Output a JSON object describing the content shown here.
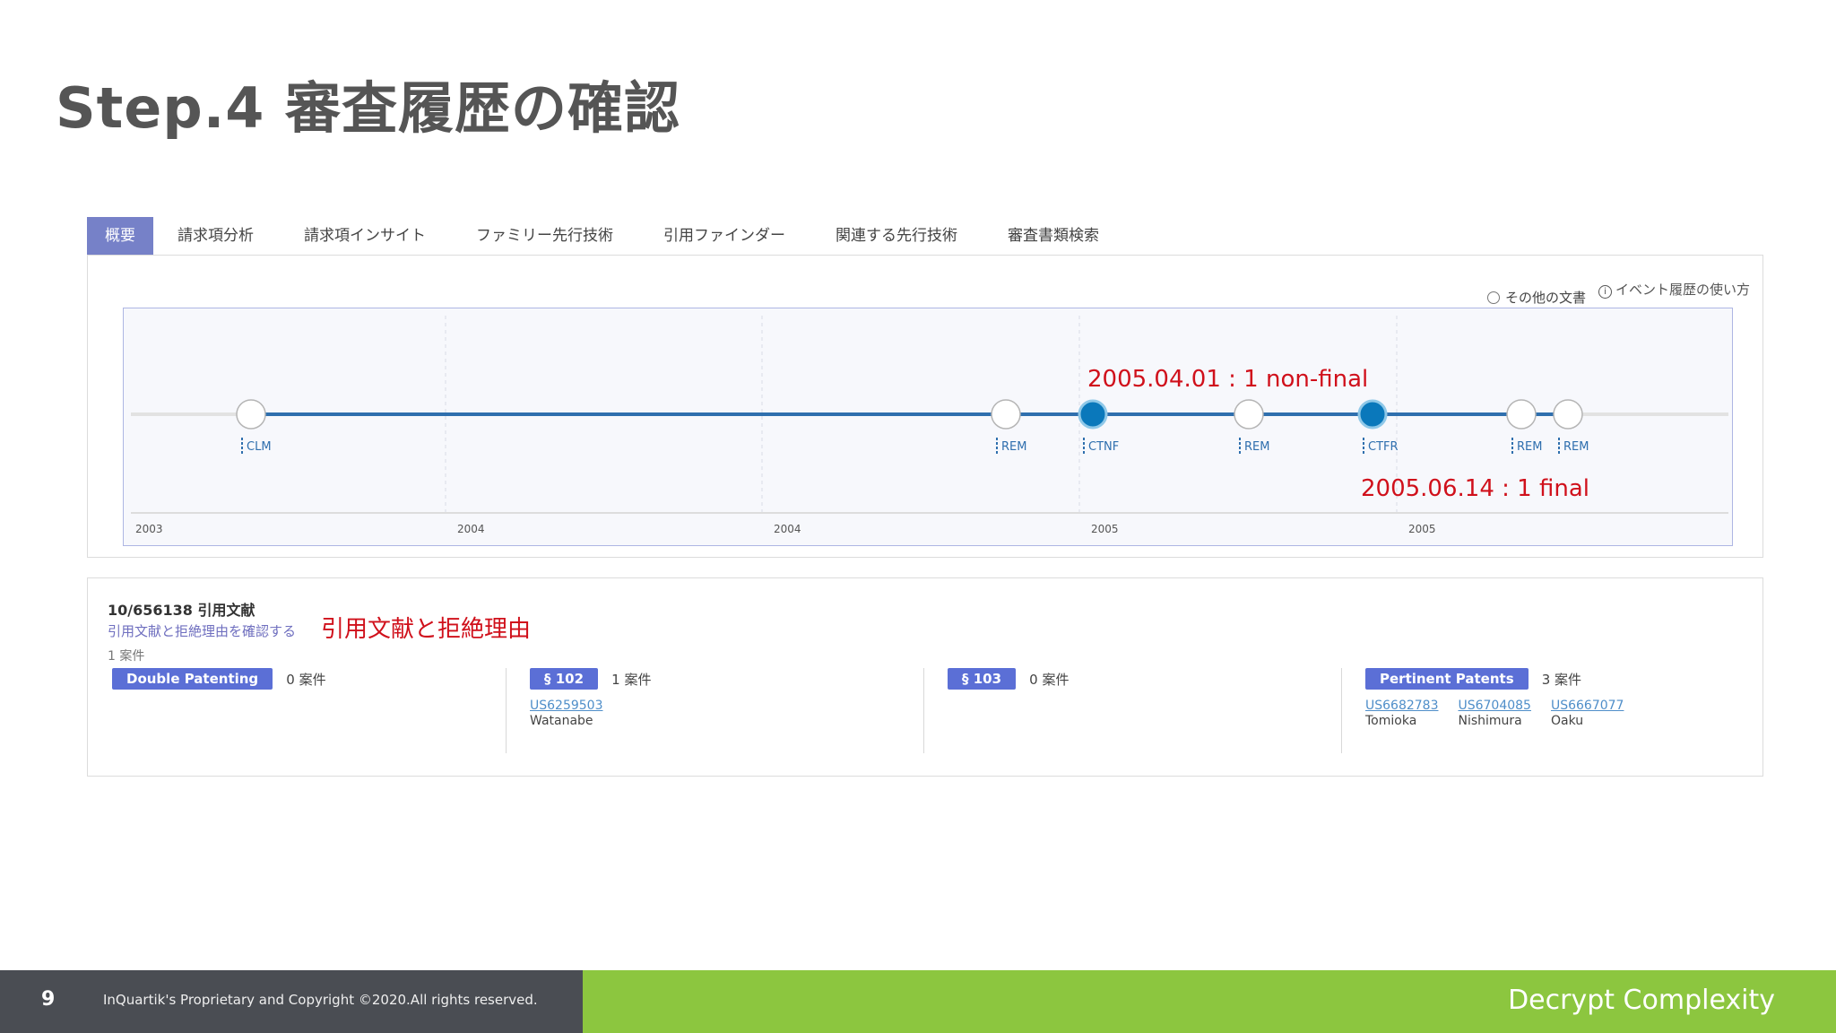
{
  "slide": {
    "title": "Step.4 審査履歴の確認",
    "page_number": "9",
    "copyright": "InQuartik's Proprietary and Copyright ©2020.All rights reserved.",
    "tagline": "Decrypt Complexity"
  },
  "tabs": [
    {
      "label": "概要",
      "active": true
    },
    {
      "label": "請求項分析"
    },
    {
      "label": "請求項インサイト"
    },
    {
      "label": "ファミリー先行技術"
    },
    {
      "label": "引用ファインダー"
    },
    {
      "label": "関連する先行技術"
    },
    {
      "label": "審査書類検索"
    }
  ],
  "legend": {
    "other_docs": "その他の文書",
    "help": "イベント履歴の使い方"
  },
  "timeline": {
    "axis_labels": [
      "2003",
      "2004",
      "2004",
      "2005",
      "2005"
    ],
    "events": [
      {
        "code": "CLM",
        "type": "other"
      },
      {
        "code": "REM",
        "type": "other"
      },
      {
        "code": "CTNF",
        "type": "rejection"
      },
      {
        "code": "REM",
        "type": "other"
      },
      {
        "code": "CTFR",
        "type": "rejection"
      },
      {
        "code": "REM",
        "type": "other"
      },
      {
        "code": "REM",
        "type": "other"
      }
    ],
    "colors": {
      "line": "#2f6fae",
      "rejection": "#0a78bb",
      "track": "#e2e2e2"
    }
  },
  "annotations": {
    "non_final": "2005.04.01 : 1 non-final",
    "final": "2005.06.14 : 1 final",
    "citations": "引用文献と拒絶理由"
  },
  "citations": {
    "title": "10/656138 引用文献",
    "link": "引用文献と拒絶理由を確認する",
    "count": "1 案件",
    "groups": [
      {
        "label": "Double Patenting",
        "count": "0 案件",
        "refs": []
      },
      {
        "label": "§ 102",
        "count": "1 案件",
        "refs": [
          {
            "number": "US6259503",
            "inventor": "Watanabe"
          }
        ]
      },
      {
        "label": "§ 103",
        "count": "0 案件",
        "refs": []
      },
      {
        "label": "Pertinent Patents",
        "count": "3 案件",
        "refs": [
          {
            "number": "US6682783",
            "inventor": "Tomioka"
          },
          {
            "number": "US6704085",
            "inventor": "Nishimura"
          },
          {
            "number": "US6667077",
            "inventor": "Oaku"
          }
        ]
      }
    ]
  }
}
